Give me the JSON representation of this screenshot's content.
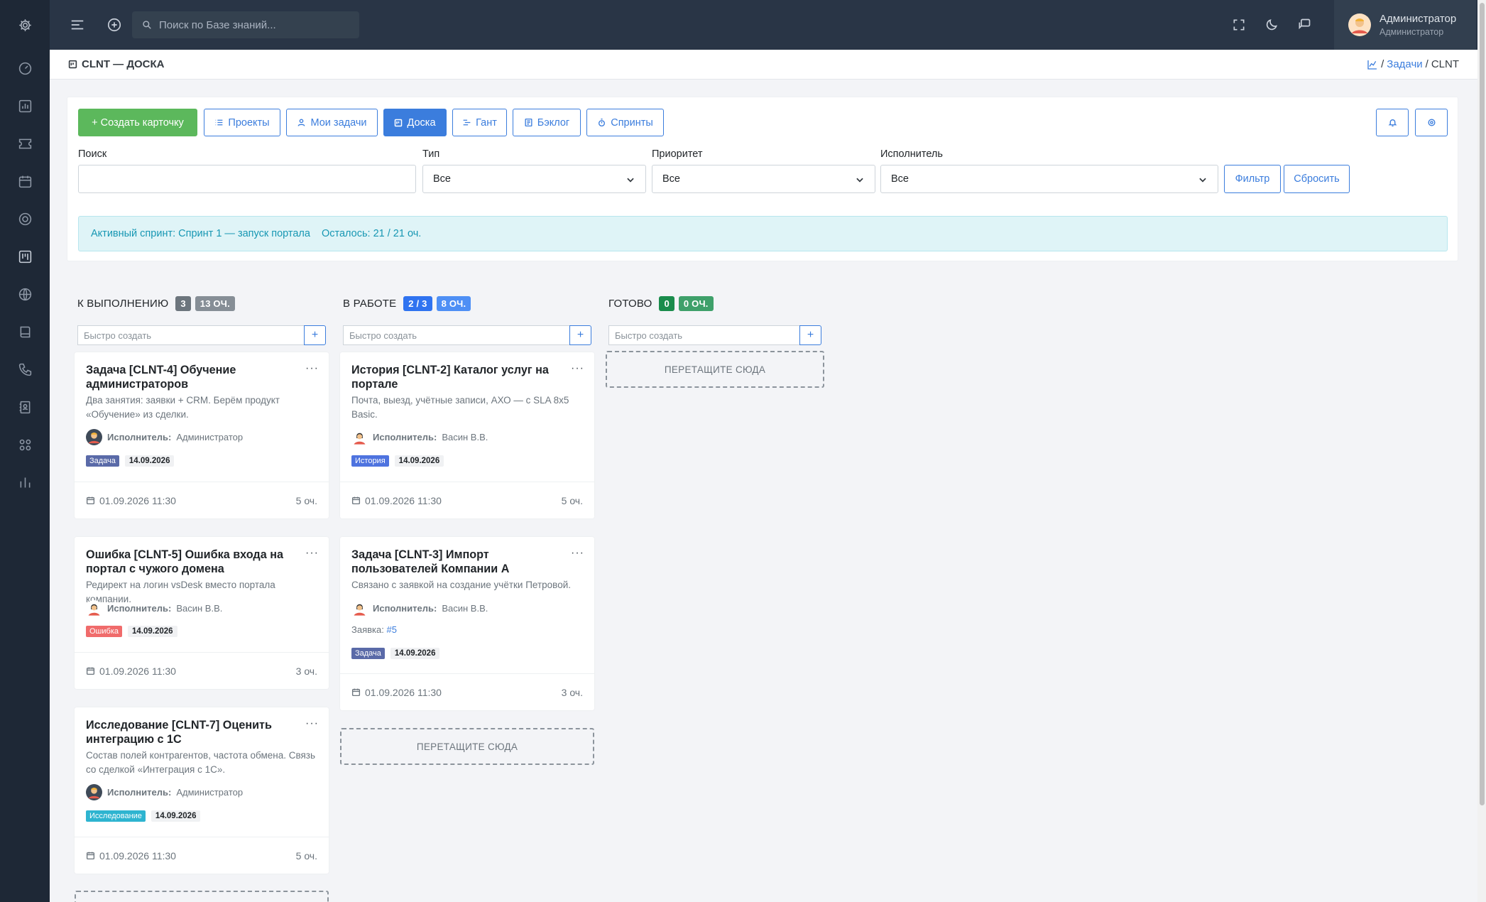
{
  "topbar": {
    "search_placeholder": "Поиск по Базе знаний...",
    "user_name": "Администратор",
    "user_role": "Администратор"
  },
  "page": {
    "title": "CLNT — ДОСКА",
    "breadcrumb": {
      "link": "Задачи",
      "current": "CLNT",
      "sep": "/"
    }
  },
  "toolbar": {
    "create": "+ Создать карточку",
    "projects": "Проекты",
    "my_tasks": "Мои задачи",
    "board": "Доска",
    "gantt": "Гант",
    "backlog": "Бэклог",
    "sprints": "Спринты"
  },
  "filters": {
    "search_label": "Поиск",
    "search_value": "",
    "type_label": "Тип",
    "type_value": "Все",
    "priority_label": "Приоритет",
    "priority_value": "Все",
    "assignee_label": "Исполнитель",
    "assignee_value": "Все",
    "filter_button": "Фильтр",
    "reset_button": "Сбросить"
  },
  "sprint_alert": {
    "label": "Активный спринт:",
    "sprint": "Спринт 1 — запуск портала",
    "remain_label": "Осталось:",
    "remain": "21 / 21 оч."
  },
  "colors": {
    "primary": "#3b7ddd",
    "success": "#5cb85c",
    "sidebar": "#1e2836",
    "topbar": "#293546",
    "tag_task": "#5a6aa8",
    "tag_story": "#4e73df",
    "tag_bug": "#f06b6b",
    "tag_research": "#2eb4d0"
  },
  "board": {
    "quick_placeholder": "Быстро создать",
    "drop_text": "ПЕРЕТАЩИТЕ СЮДА",
    "assignee_label": "Исполнитель:",
    "ticket_label": "Заявка:",
    "columns": [
      {
        "title": "К ВЫПОЛНЕНИЮ",
        "count": "3",
        "points": "13 ОЧ.",
        "cards": [
          {
            "title": "Задача [CLNT-4] Обучение администраторов",
            "desc": "Два занятия: заявки + CRM. Берём продукт «Обучение» из сделки.",
            "assignee": "Администратор",
            "tag": "Задача",
            "due": "14.09.2026",
            "date": "01.09.2026 11:30",
            "points": "5 оч."
          },
          {
            "title": "Ошибка [CLNT-5] Ошибка входа на портал с чужого домена",
            "desc": "Редирект на логин vsDesk вместо портала компании.",
            "assignee": "Васин В.В.",
            "tag": "Ошибка",
            "due": "14.09.2026",
            "date": "01.09.2026 11:30",
            "points": "3 оч."
          },
          {
            "title": "Исследование [CLNT-7] Оценить интеграцию с 1С",
            "desc": "Состав полей контрагентов, частота обмена. Связь со сделкой «Интеграция с 1С».",
            "assignee": "Администратор",
            "tag": "Исследование",
            "due": "14.09.2026",
            "date": "01.09.2026 11:30",
            "points": "5 оч."
          }
        ]
      },
      {
        "title": "В РАБОТЕ",
        "count": "2 / 3",
        "points": "8 ОЧ.",
        "cards": [
          {
            "title": "История [CLNT-2] Каталог услуг на портале",
            "desc": "Почта, выезд, учётные записи, АХО — с SLA 8x5 Basic.",
            "assignee": "Васин В.В.",
            "tag": "История",
            "due": "14.09.2026",
            "date": "01.09.2026 11:30",
            "points": "5 оч."
          },
          {
            "title": "Задача [CLNT-3] Импорт пользователей Компании А",
            "desc": "Связано с заявкой на создание учётки Петровой.",
            "assignee": "Васин В.В.",
            "ticket": "#5",
            "tag": "Задача",
            "due": "14.09.2026",
            "date": "01.09.2026 11:30",
            "points": "3 оч."
          }
        ]
      },
      {
        "title": "ГОТОВО",
        "count": "0",
        "points": "0 ОЧ.",
        "cards": []
      }
    ]
  }
}
